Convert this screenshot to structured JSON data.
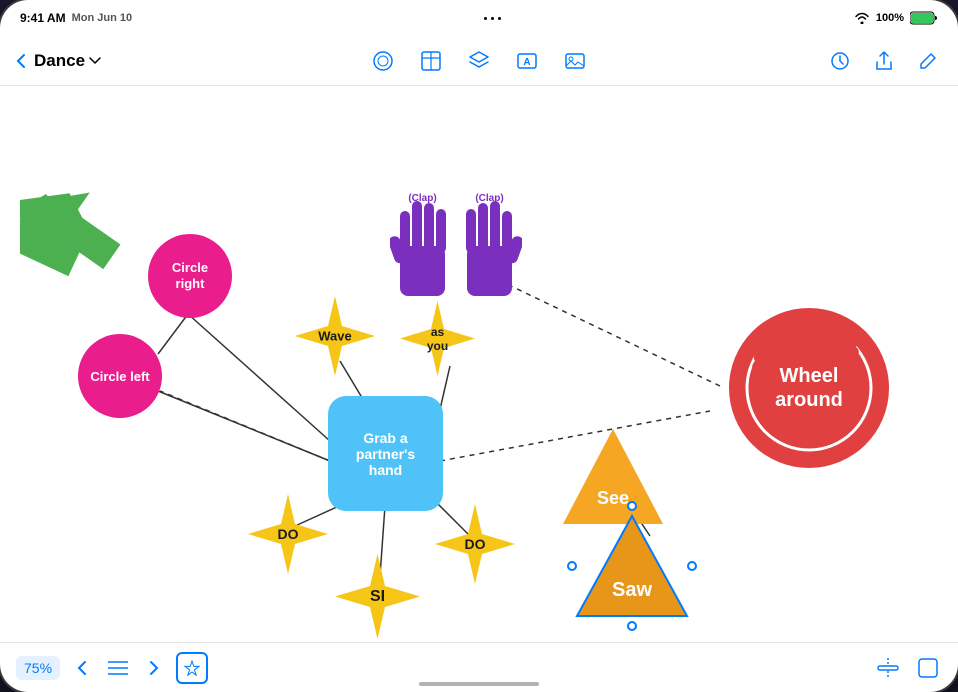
{
  "device": {
    "time": "9:41 AM",
    "date": "Mon Jun 10",
    "battery": "100%",
    "dots": [
      "·",
      "·",
      "·"
    ]
  },
  "header": {
    "back_label": "Back",
    "title": "Dance",
    "toolbar_icons": [
      "circle-icon",
      "square-icon",
      "layers-icon",
      "text-icon",
      "image-icon"
    ],
    "right_icons": [
      "clock-icon",
      "share-icon",
      "edit-icon"
    ]
  },
  "canvas": {
    "shapes": [
      {
        "id": "circle-right",
        "label": "Circle\nright",
        "type": "circle",
        "color": "#E91E8C"
      },
      {
        "id": "circle-left",
        "label": "Circle\nleft",
        "type": "circle",
        "color": "#E91E8C"
      },
      {
        "id": "center",
        "label": "Grab a\npartner's\nhand",
        "type": "rounded-rect",
        "color": "#4FC3F7"
      },
      {
        "id": "wave",
        "label": "Wave",
        "type": "star4pt",
        "color": "#F5C518"
      },
      {
        "id": "as-you",
        "label": "as\nyou",
        "type": "star4pt",
        "color": "#F5C518"
      },
      {
        "id": "do1",
        "label": "DO",
        "type": "star4pt",
        "color": "#F5C518"
      },
      {
        "id": "do2",
        "label": "DO",
        "type": "star4pt",
        "color": "#F5C518"
      },
      {
        "id": "si",
        "label": "SI",
        "type": "star4pt",
        "color": "#F5C518"
      },
      {
        "id": "wheel-around",
        "label": "Wheel\naround",
        "type": "scallop",
        "color": "#E04040"
      },
      {
        "id": "see",
        "label": "See",
        "type": "triangle",
        "color": "#F5A623"
      },
      {
        "id": "saw",
        "label": "Saw",
        "type": "triangle",
        "color": "#E8961A"
      },
      {
        "id": "clap1",
        "label": "(Clap)",
        "type": "hand",
        "color": "#7B2FBE"
      },
      {
        "id": "clap2",
        "label": "(Clap)",
        "type": "hand",
        "color": "#7B2FBE"
      }
    ]
  },
  "bottom_bar": {
    "zoom": "75%",
    "nav_prev": "‹",
    "nav_next": "›"
  }
}
